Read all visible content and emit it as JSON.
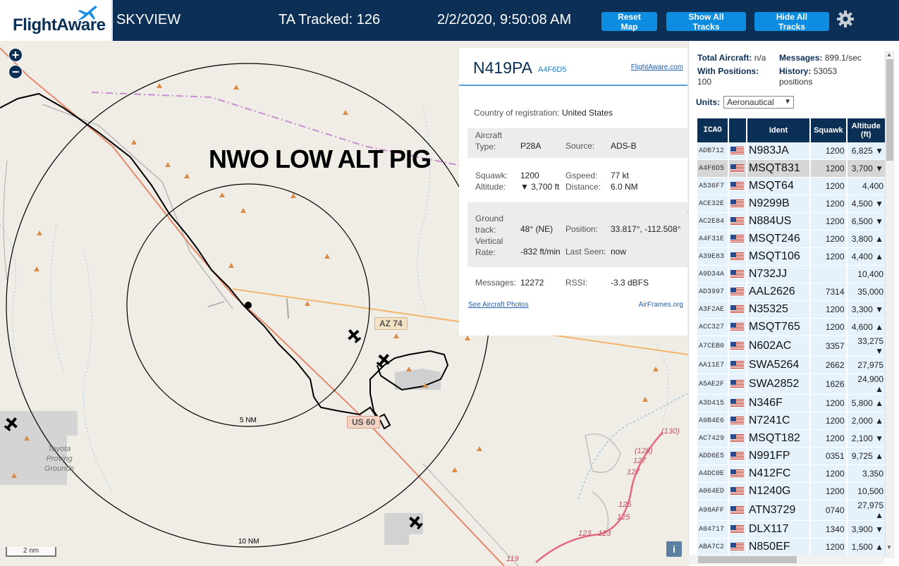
{
  "header": {
    "logo_text": "FlightAware",
    "app_title": "SKYVIEW",
    "ta_tracked": "TA Tracked: 126",
    "datetime": "2/2/2020, 9:50:08 AM",
    "reset_map": "Reset Map",
    "show_all": "Show All Tracks",
    "hide_all": "Hide All Tracks",
    "settings_icon": "gear-icon"
  },
  "map": {
    "zoom_in": "+",
    "zoom_out": "−",
    "annotation": "NWO LOW ALT PIG",
    "ring_5": "5 NM",
    "ring_10": "10 NM",
    "road_az74": "AZ 74",
    "road_us60": "US 60",
    "proving_grounds": "Toyota Proving Grounds",
    "scale": "2 nm",
    "info": "i",
    "route_numbers": [
      "(130)",
      "(128)",
      "127",
      "127",
      "125",
      "125",
      "123",
      "123",
      "119"
    ]
  },
  "detail": {
    "ident": "N419PA",
    "hex": "A4F6D5",
    "fa_link": "FlightAware.com",
    "country_label": "Country of registration:",
    "country": "United States",
    "aircraft_type_label": "Aircraft Type:",
    "aircraft_type": "P28A",
    "source_label": "Source:",
    "source": "ADS-B",
    "squawk_label": "Squawk:",
    "squawk": "1200",
    "gspeed_label": "Gspeed:",
    "gspeed": "77 kt",
    "altitude_label": "Altitude:",
    "altitude": "▼ 3,700 ft",
    "distance_label": "Distance:",
    "distance": "6.0 NM",
    "ground_track_label": "Ground track:",
    "ground_track": "48° (NE)",
    "position_label": "Position:",
    "position": "33.817°, -112.508°",
    "vrate_label": "Vertical Rate:",
    "vrate": "-832 ft/min",
    "last_seen_label": "Last Seen:",
    "last_seen": "now",
    "messages_label": "Messages:",
    "messages": "12272",
    "rssi_label": "RSSI:",
    "rssi": "-3.3 dBFS",
    "photos_link": "See Aircraft Photos",
    "airframes_link": "AirFrames.org"
  },
  "sidebar": {
    "total_aircraft_label": "Total Aircraft:",
    "total_aircraft": "n/a",
    "messages_label": "Messages:",
    "messages": "899.1/sec",
    "with_positions_label": "With Positions:",
    "with_positions": "100",
    "history_label": "History:",
    "history": "53053",
    "history_unit": "positions",
    "units_label": "Units:",
    "units_value": "Aeronautical",
    "columns": [
      "ICAO",
      "Ident",
      "Squawk",
      "Altitude (ft)"
    ],
    "rows": [
      {
        "icao": "ADB712",
        "ident": "N983JA",
        "squawk": "1200",
        "alt": "6,825 ▼"
      },
      {
        "icao": "A4F6D5",
        "ident": "MSQT831",
        "squawk": "1200",
        "alt": "3,700 ▼",
        "selected": true
      },
      {
        "icao": "A536F7",
        "ident": "MSQT64",
        "squawk": "1200",
        "alt": "4,400"
      },
      {
        "icao": "ACE32E",
        "ident": "N9299B",
        "squawk": "1200",
        "alt": "4,500 ▼"
      },
      {
        "icao": "AC2E84",
        "ident": "N884US",
        "squawk": "1200",
        "alt": "6,500 ▼"
      },
      {
        "icao": "A4F31E",
        "ident": "MSQT246",
        "squawk": "1200",
        "alt": "3,800 ▲"
      },
      {
        "icao": "A39E83",
        "ident": "MSQT106",
        "squawk": "1200",
        "alt": "4,400 ▲"
      },
      {
        "icao": "A9D34A",
        "ident": "N732JJ",
        "squawk": "",
        "alt": "10,400"
      },
      {
        "icao": "AD3997",
        "ident": "AAL2626",
        "squawk": "7314",
        "alt": "35,000"
      },
      {
        "icao": "A3F2AE",
        "ident": "N35325",
        "squawk": "1200",
        "alt": "3,300 ▼"
      },
      {
        "icao": "ACC327",
        "ident": "MSQT765",
        "squawk": "1200",
        "alt": "4,600 ▲"
      },
      {
        "icao": "A7CEB0",
        "ident": "N602AC",
        "squawk": "3357",
        "alt": "33,275 ▼"
      },
      {
        "icao": "AA11E7",
        "ident": "SWA5264",
        "squawk": "2662",
        "alt": "27,975"
      },
      {
        "icao": "A5AE2F",
        "ident": "SWA2852",
        "squawk": "1626",
        "alt": "24,900 ▲"
      },
      {
        "icao": "A3D415",
        "ident": "N346F",
        "squawk": "1200",
        "alt": "5,800 ▲"
      },
      {
        "icao": "A9B4E6",
        "ident": "N7241C",
        "squawk": "1200",
        "alt": "2,000 ▲"
      },
      {
        "icao": "AC7429",
        "ident": "MSQT182",
        "squawk": "1200",
        "alt": "2,100 ▼"
      },
      {
        "icao": "ADD6E5",
        "ident": "N991FP",
        "squawk": "0351",
        "alt": "9,725 ▲"
      },
      {
        "icao": "A4DC0E",
        "ident": "N412FC",
        "squawk": "1200",
        "alt": "3,350"
      },
      {
        "icao": "A064ED",
        "ident": "N1240G",
        "squawk": "1200",
        "alt": "10,500"
      },
      {
        "icao": "A98AFF",
        "ident": "ATN3729",
        "squawk": "0740",
        "alt": "27,975 ▲"
      },
      {
        "icao": "A04717",
        "ident": "DLX117",
        "squawk": "1340",
        "alt": "3,900 ▼"
      },
      {
        "icao": "ABA7C2",
        "ident": "N850EF",
        "squawk": "1200",
        "alt": "1,500 ▲"
      }
    ]
  },
  "colors": {
    "header_bg": "#0c2f55",
    "button_bg": "#0c8de0",
    "row_bg": "#e6f2fb",
    "selected_row_bg": "#d6d6d6"
  }
}
